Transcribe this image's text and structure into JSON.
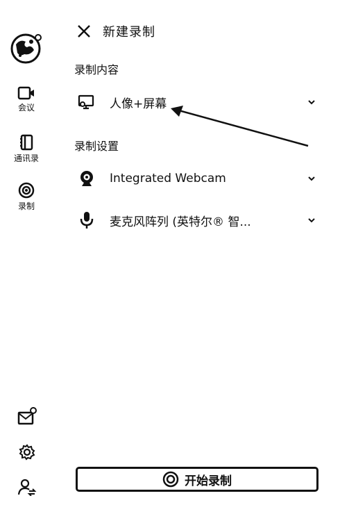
{
  "sidebar": {
    "items": [
      {
        "label": "会议",
        "icon": "video-camera-icon"
      },
      {
        "label": "通讯录",
        "icon": "contacts-book-icon"
      },
      {
        "label": "录制",
        "icon": "record-icon"
      }
    ],
    "bottom_icons": [
      "mail-notification-icon",
      "settings-gear-icon",
      "user-switch-icon"
    ]
  },
  "header": {
    "title": "新建录制"
  },
  "sections": {
    "content": "录制内容",
    "settings": "录制设置"
  },
  "content_option": {
    "value": "人像+屏幕",
    "icon": "monitor-person-icon"
  },
  "camera": {
    "value": "Integrated Webcam",
    "icon": "webcam-icon"
  },
  "microphone": {
    "value": "麦克风阵列 (英特尔® 智...",
    "icon": "microphone-icon"
  },
  "start_button": {
    "label": "开始录制"
  }
}
